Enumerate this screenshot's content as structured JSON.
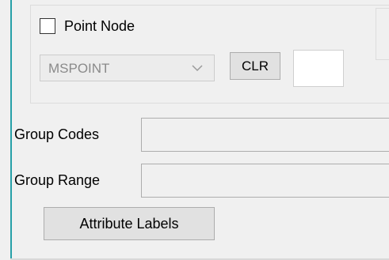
{
  "point_node": {
    "checkbox_label": "Point Node",
    "checked": false
  },
  "point_combo": {
    "value": "MSPOINT"
  },
  "clr_button": {
    "label": "CLR"
  },
  "clr_input": {
    "value": ""
  },
  "group_codes": {
    "label": "Group Codes",
    "value": ""
  },
  "group_range": {
    "label": "Group Range",
    "value": ""
  },
  "attribute_labels_button": {
    "label": "Attribute Labels"
  },
  "icons": {
    "combo_arrow": "chevron-down-icon"
  },
  "colors": {
    "accent_line": "#26a0a8",
    "panel_background": "#f0f0f0"
  }
}
